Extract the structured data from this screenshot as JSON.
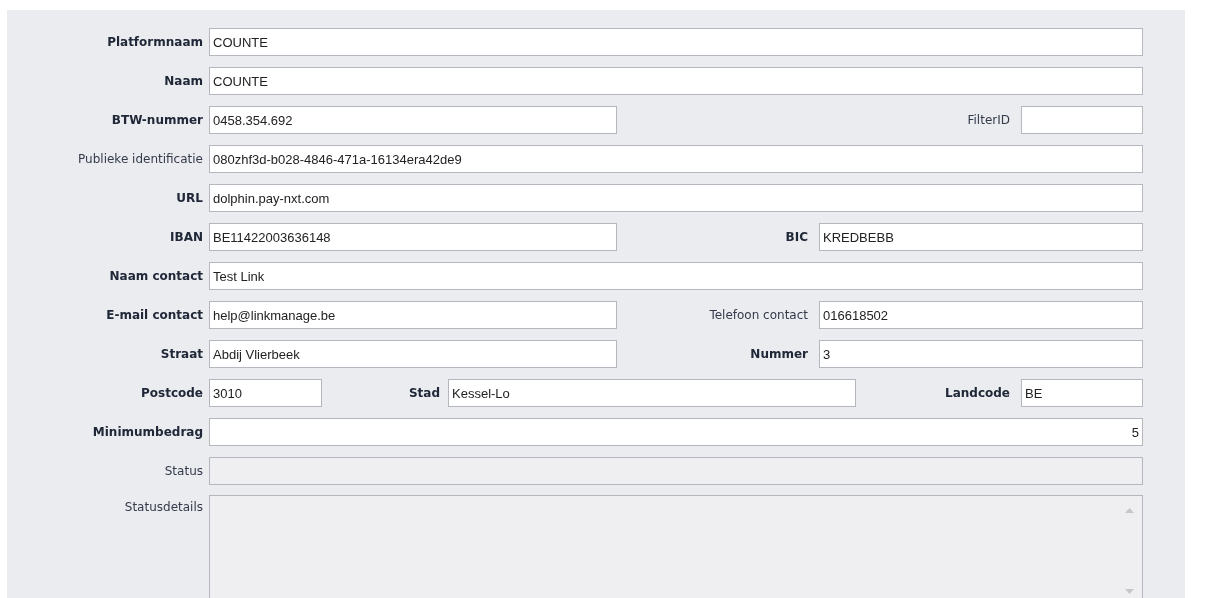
{
  "form": {
    "rows": [
      {
        "kind": "full",
        "fields": [
          {
            "label": "Platformnaam",
            "bold": true,
            "value": "COUNTE",
            "disabled": false
          }
        ]
      },
      {
        "kind": "full",
        "fields": [
          {
            "label": "Naam",
            "bold": true,
            "value": "COUNTE",
            "disabled": false
          }
        ]
      },
      {
        "kind": "split-narrow",
        "fields": [
          {
            "label": "BTW-nummer",
            "bold": true,
            "value": "0458.354.692",
            "disabled": false
          },
          {
            "label": "FilterID",
            "bold": false,
            "disabled": false
          }
        ]
      },
      {
        "kind": "full",
        "fields": [
          {
            "label": "Publieke identificatie",
            "bold": false,
            "value": "080zhf3d-b028-4846-471a-16134era42de9",
            "disabled": false
          }
        ]
      },
      {
        "kind": "full",
        "fields": [
          {
            "label": "URL",
            "bold": true,
            "value": "dolphin.pay-nxt.com",
            "disabled": false
          }
        ]
      },
      {
        "kind": "split",
        "fields": [
          {
            "label": "IBAN",
            "bold": true,
            "value": "BE11422003636148",
            "disabled": false
          },
          {
            "label": "BIC",
            "bold": true,
            "value": "KREDBEBB",
            "disabled": false
          }
        ]
      },
      {
        "kind": "full",
        "fields": [
          {
            "label": "Naam contact",
            "bold": true,
            "value": "Test Link",
            "disabled": false
          }
        ]
      },
      {
        "kind": "split",
        "fields": [
          {
            "label": "E-mail contact",
            "bold": true,
            "value": "help@linkmanage.be",
            "disabled": false
          },
          {
            "label": "Telefoon contact",
            "bold": false,
            "value": "016618502",
            "disabled": false
          }
        ]
      },
      {
        "kind": "split",
        "fields": [
          {
            "label": "Straat",
            "bold": true,
            "value": "Abdij Vlierbeek",
            "disabled": false
          },
          {
            "label": "Nummer",
            "bold": true,
            "value": "3",
            "disabled": false
          }
        ]
      },
      {
        "kind": "triple",
        "fields": [
          {
            "label": "Postcode",
            "bold": true,
            "value": "3010",
            "disabled": false
          },
          {
            "label": "Stad",
            "bold": true,
            "value": "Kessel-Lo",
            "disabled": false
          },
          {
            "label": "Landcode",
            "bold": true,
            "value": "BE",
            "disabled": false
          }
        ]
      },
      {
        "kind": "number",
        "fields": [
          {
            "label": "Minimumbedrag",
            "bold": true,
            "value": "5",
            "disabled": false
          }
        ]
      },
      {
        "kind": "full",
        "fields": [
          {
            "label": "Status",
            "bold": false,
            "disabled": true
          }
        ]
      },
      {
        "kind": "memo",
        "fields": [
          {
            "label": "Statusdetails",
            "bold": false,
            "disabled": true
          }
        ]
      }
    ]
  }
}
